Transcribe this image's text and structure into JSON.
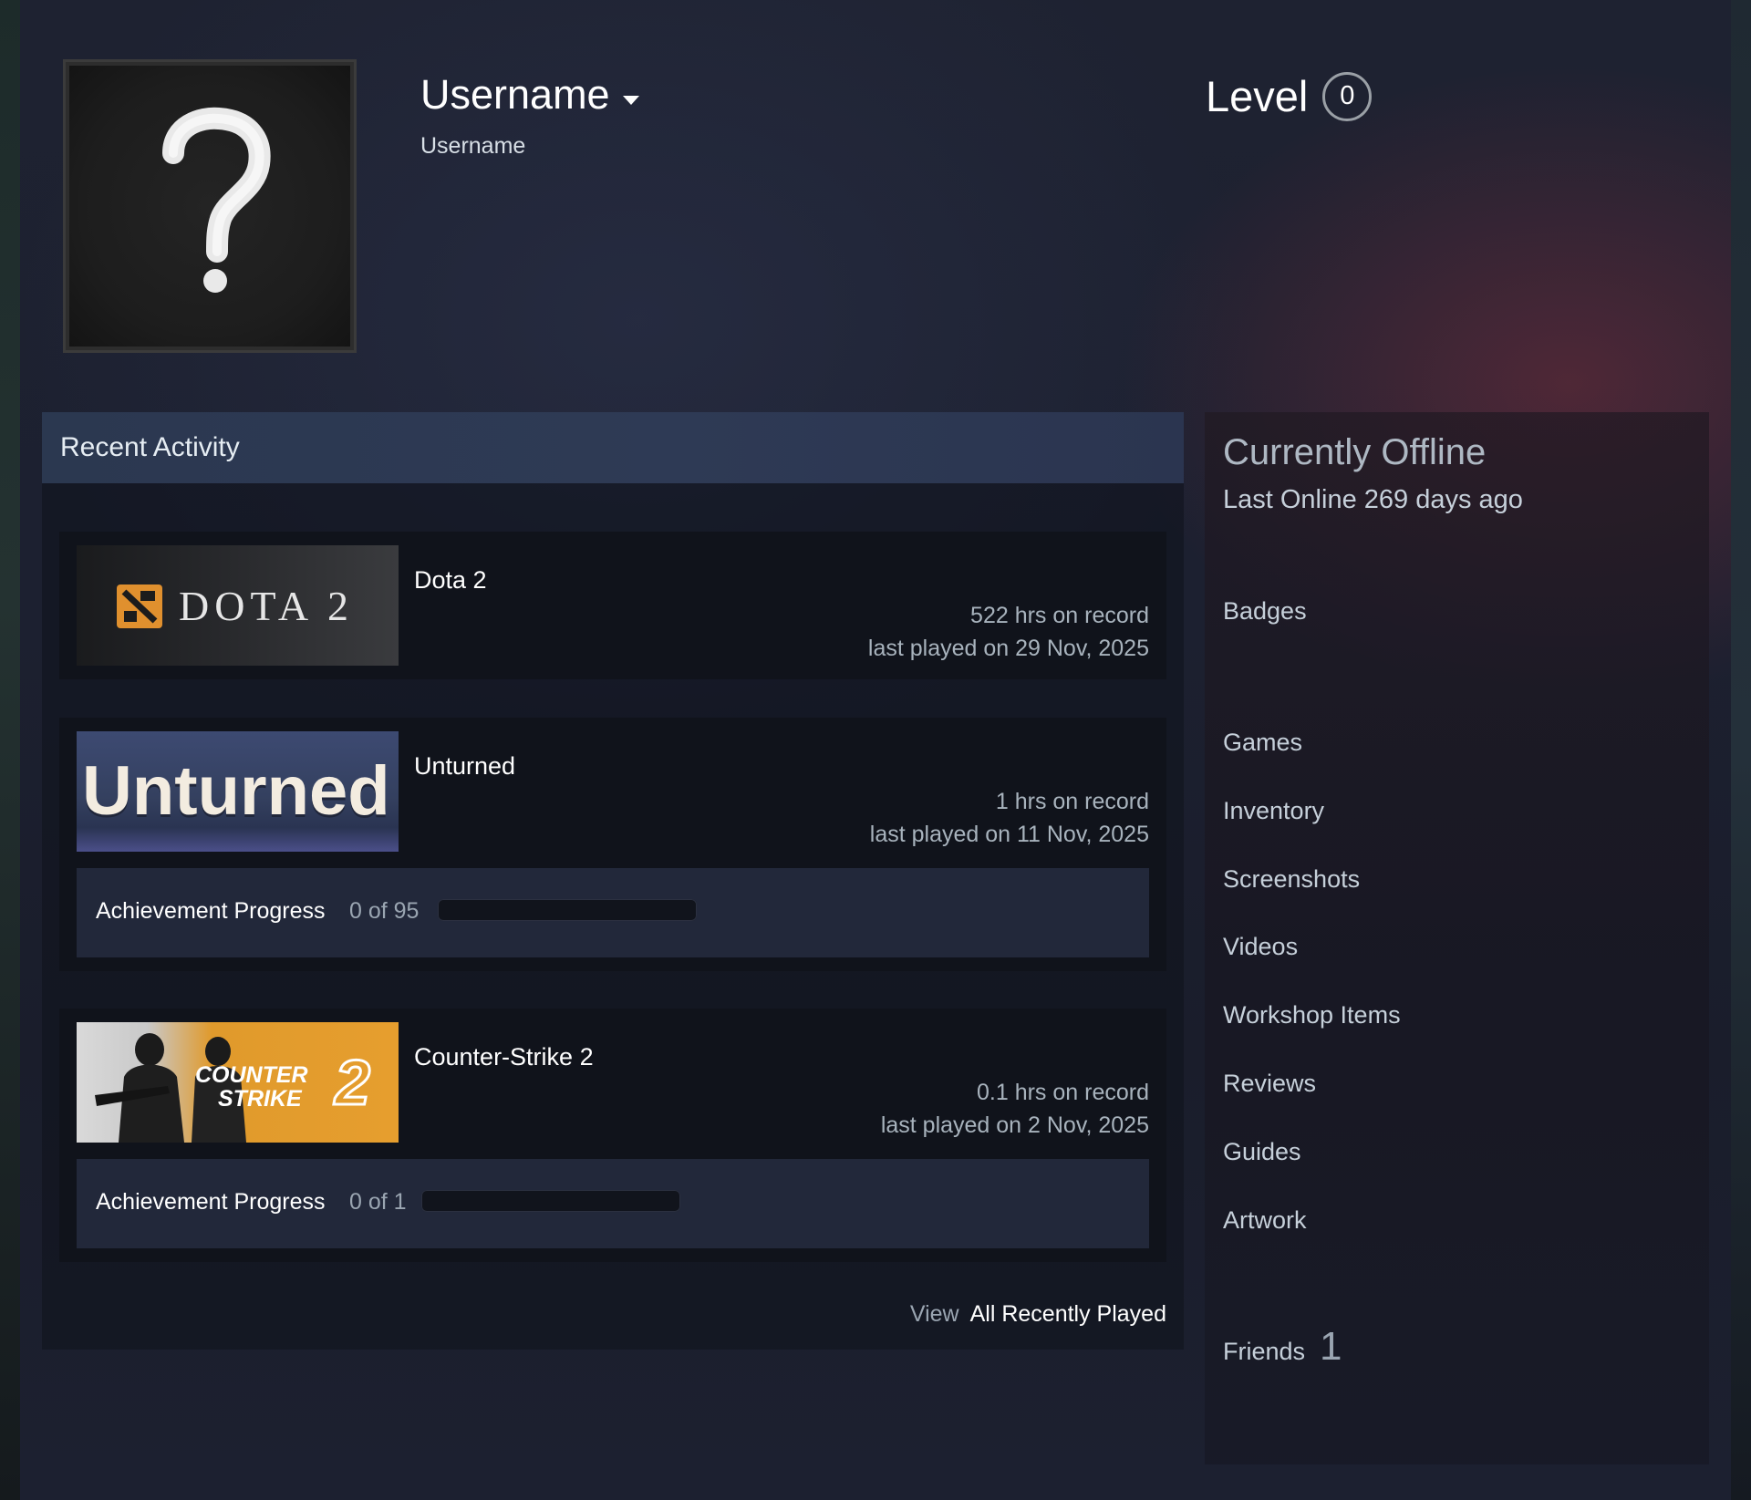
{
  "header": {
    "persona_name": "Username",
    "real_name": "Username",
    "level_label": "Level",
    "level_value": "0"
  },
  "recent_activity": {
    "title": "Recent Activity",
    "games": [
      {
        "name": "Dota 2",
        "capsule_icon": "dota-2-logo",
        "capsule_text": "DOTA 2",
        "hours": "522 hrs on record",
        "last_played": "last played on 29 Nov, 2025"
      },
      {
        "name": "Unturned",
        "capsule_icon": "unturned-logo",
        "capsule_text": "Unturned",
        "hours": "1 hrs on record",
        "last_played": "last played on 11 Nov, 2025",
        "achievement": {
          "label": "Achievement Progress",
          "count": "0 of 95",
          "progress": 0
        }
      },
      {
        "name": "Counter-Strike 2",
        "capsule_icon": "counter-strike-2-logo",
        "capsule_text_line1": "COUNTER",
        "capsule_text_line2": "STRIKE",
        "capsule_text_num": "2",
        "hours": "0.1 hrs on record",
        "last_played": "last played on 2 Nov, 2025",
        "achievement": {
          "label": "Achievement Progress",
          "count": "0 of 1",
          "progress": 0
        }
      }
    ],
    "view_label": "View",
    "view_all_label": "All Recently Played"
  },
  "sidebar": {
    "status": "Currently Offline",
    "last_online": "Last Online 269 days ago",
    "links": [
      "Badges",
      "Games",
      "Inventory",
      "Screenshots",
      "Videos",
      "Workshop Items",
      "Reviews",
      "Guides",
      "Artwork"
    ],
    "friends_label": "Friends",
    "friends_count": "1"
  },
  "colors": {
    "accent": "#66c0f4",
    "dota_orange": "#e0902e",
    "cs2_orange": "#e09a2c",
    "unturned_bg": "#2f3a5c"
  }
}
